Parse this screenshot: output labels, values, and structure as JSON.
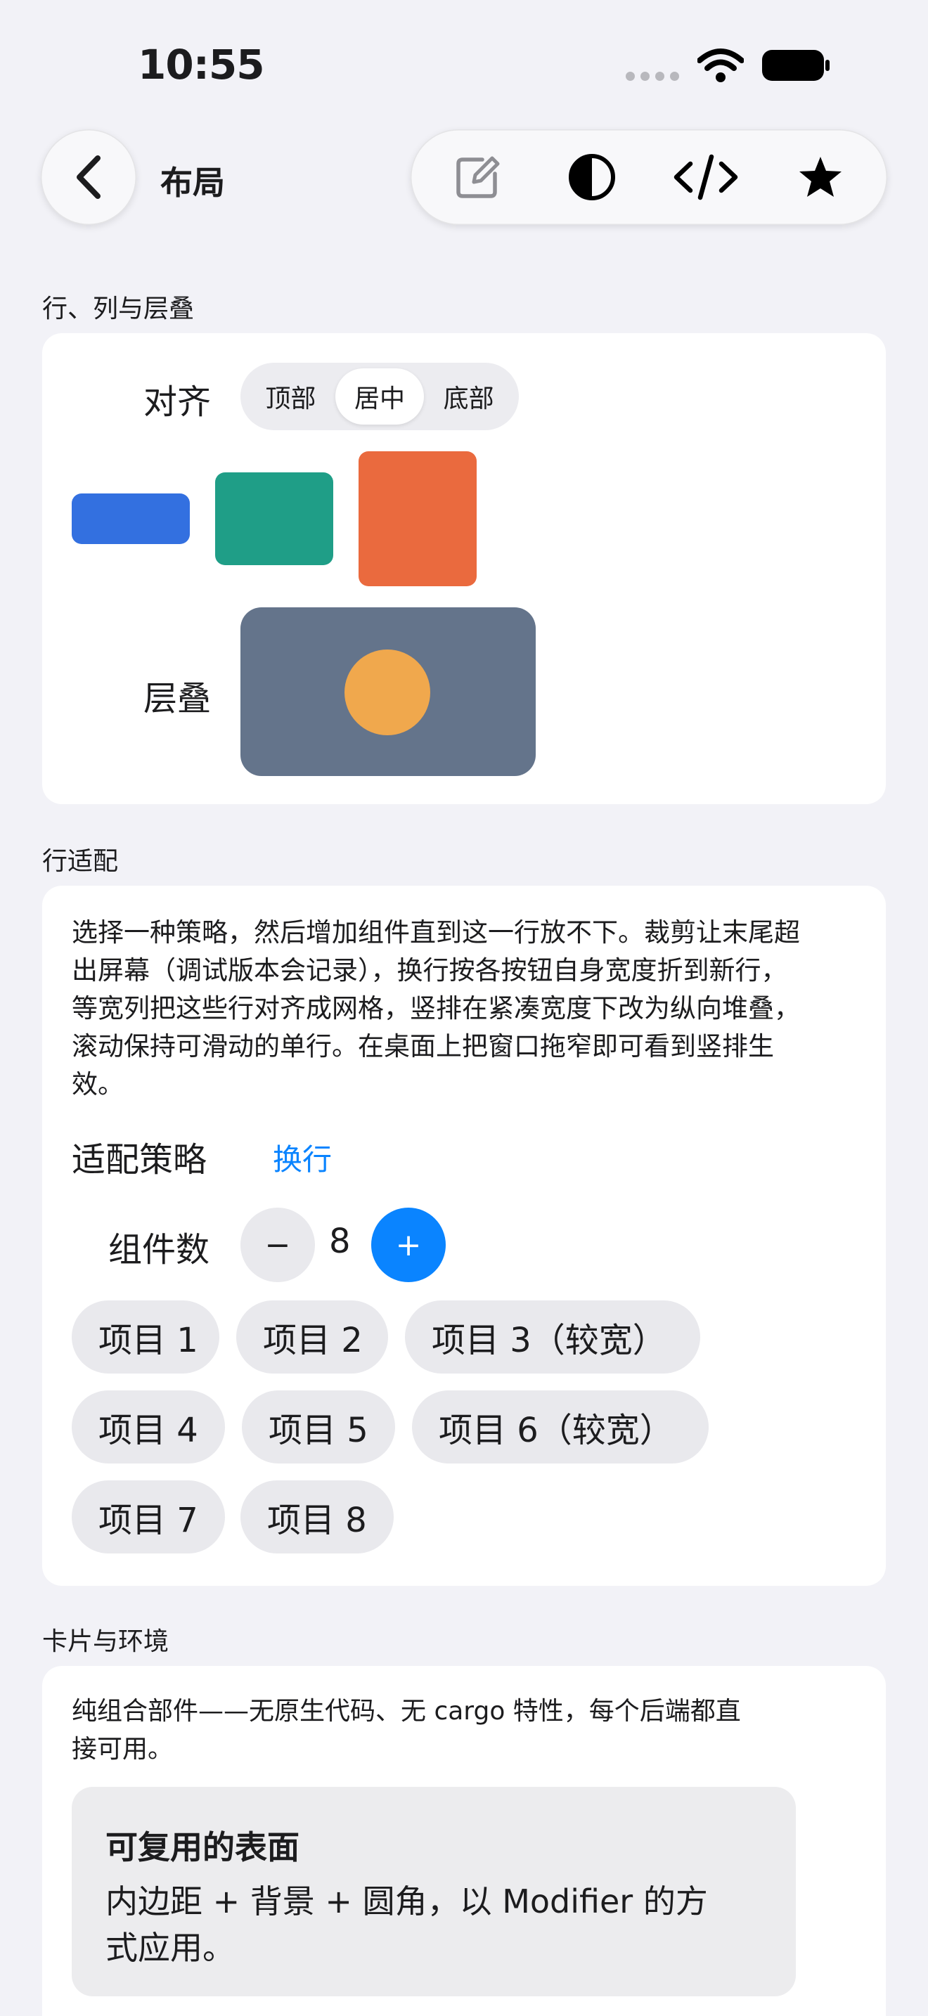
{
  "status": {
    "time": "10:55"
  },
  "nav": {
    "title": "布局"
  },
  "sections": {
    "row_col_stack": "行、列与层叠",
    "row_fit": "行适配",
    "card_env": "卡片与环境"
  },
  "align": {
    "label": "对齐",
    "options": [
      "顶部",
      "居中",
      "底部"
    ],
    "selected": "居中"
  },
  "colors": {
    "blue": "#3370e0",
    "teal": "#1f9e87",
    "orange": "#ea6a3e",
    "slate": "#64748b",
    "amber": "#f0a84d",
    "accent": "#0a84ff"
  },
  "stack": {
    "label": "层叠"
  },
  "row_fit": {
    "description_lines": [
      "选择一种策略，然后增加组件直到这一行放不下。裁剪让末尾超",
      "出屏幕（调试版本会记录），换行按各按钮自身宽度折到新行，",
      "等宽列把这些行对齐成网格，竖排在紧凑宽度下改为纵向堆叠，",
      "滚动保持可滑动的单行。在桌面上把窗口拖窄即可看到竖排生",
      "效。"
    ],
    "strategy_label": "适配策略",
    "strategy_value": "换行",
    "count_label": "组件数",
    "minus": "−",
    "plus": "+",
    "count": "8",
    "items": [
      "项目 1",
      "项目 2",
      "项目 3（较宽）",
      "项目 4",
      "项目 5",
      "项目 6（较宽）",
      "项目 7",
      "项目 8"
    ]
  },
  "card_env": {
    "description_lines": [
      "纯组合部件——无原生代码、无 cargo 特性，每个后端都直",
      "接可用。"
    ],
    "surface_title": "可复用的表面",
    "surface_body_lines": [
      "内边距 + 背景 + 圆角，以 Modifier 的方",
      "式应用。"
    ]
  },
  "icons": {
    "back": "chevron-left-icon",
    "edit": "edit-icon",
    "theme": "contrast-icon",
    "code": "code-icon",
    "favorite": "star-icon"
  }
}
